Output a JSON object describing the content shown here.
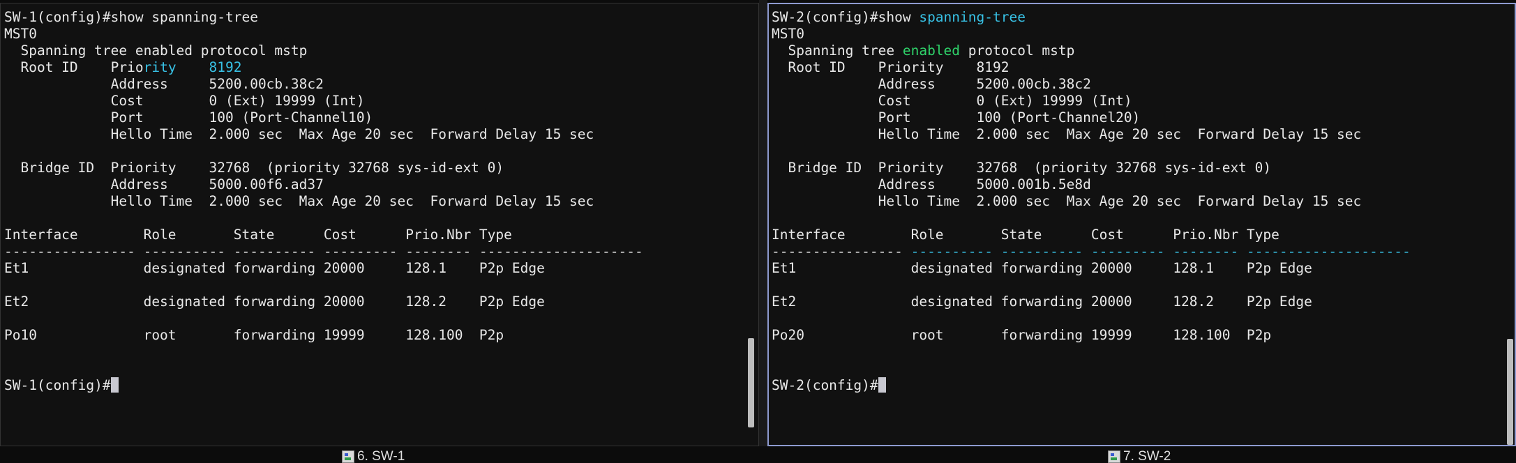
{
  "left": {
    "lines": [
      "SW-1(config)#show spanning-tree",
      "MST0",
      "  Spanning tree enabled protocol mstp",
      "  Root ID    Priority    8192",
      "             Address     5200.00cb.38c2",
      "             Cost        0 (Ext) 19999 (Int)",
      "             Port        100 (Port-Channel10)",
      "             Hello Time  2.000 sec  Max Age 20 sec  Forward Delay 15 sec",
      "",
      "  Bridge ID  Priority    32768  (priority 32768 sys-id-ext 0)",
      "             Address     5000.00f6.ad37",
      "             Hello Time  2.000 sec  Max Age 20 sec  Forward Delay 15 sec",
      "",
      "Interface        Role       State      Cost      Prio.Nbr Type",
      "---------------- ---------- ---------- --------- -------- --------------------",
      "Et1              designated forwarding 20000     128.1    P2p Edge",
      "",
      "Et2              designated forwarding 20000     128.2    P2p Edge",
      "",
      "Po10             root       forwarding 19999     128.100  P2p",
      "",
      ""
    ],
    "root_priority_label_a": "  Root ID    Prio",
    "root_priority_label_b": "rity",
    "root_priority_value": "8192",
    "prompt": "SW-1(config)#"
  },
  "right": {
    "lines": [
      "MST0",
      "  Spanning tree ",
      "  Root ID    Priority    8192",
      "             Address     5200.00cb.38c2",
      "             Cost        0 (Ext) 19999 (Int)",
      "             Port        100 (Port-Channel20)",
      "             Hello Time  2.000 sec  Max Age 20 sec  Forward Delay 15 sec",
      "",
      "  Bridge ID  Priority    32768  (priority 32768 sys-id-ext 0)",
      "             Address     5000.001b.5e8d",
      "             Hello Time  2.000 sec  Max Age 20 sec  Forward Delay 15 sec",
      "",
      "Interface        Role       State      Cost      Prio.Nbr Type",
      "----------------",
      "Et1              designated forwarding 20000     128.1    P2p Edge",
      "",
      "Et2              designated forwarding 20000     128.2    P2p Edge",
      "",
      "Po20             root       forwarding 19999     128.100  P2p",
      "",
      ""
    ],
    "command_prompt": "SW-2(config)#show ",
    "command_arg": "spanning-tree",
    "enabled_word": "enabled",
    "protocol_tail": " protocol mstp",
    "dash_tail": " ---------- ---------- --------- -------- --------------------",
    "prompt": "SW-2(config)#"
  },
  "tabs": [
    {
      "label": "6. SW-1"
    },
    {
      "label": "7. SW-2"
    }
  ],
  "colors": {
    "highlight_cyan": "#38c2e6",
    "highlight_green": "#2fd36a",
    "active_pane_border": "#8e9ad0"
  },
  "icons": {
    "tab_icon": "session-icon"
  }
}
